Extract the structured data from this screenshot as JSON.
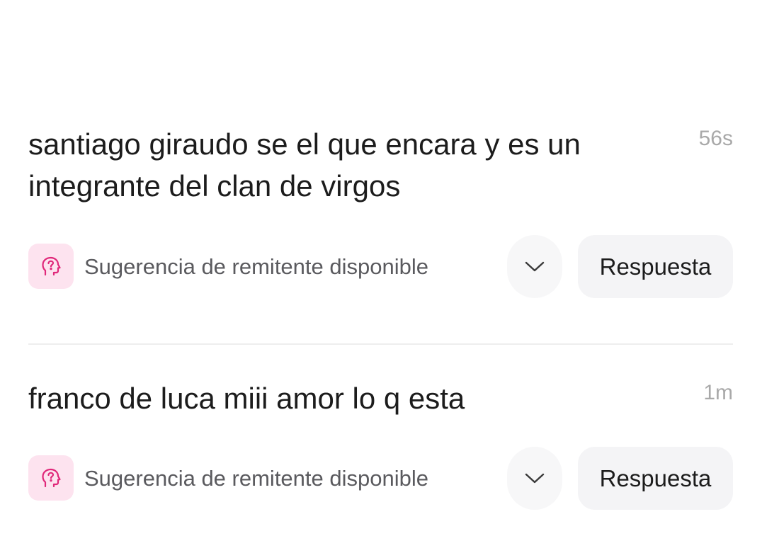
{
  "messages": [
    {
      "text": "santiago giraudo se el que encara y es un integrante del clan de virgos",
      "time": "56s",
      "suggestion_label": "Sugerencia de remitente disponible",
      "suggestion_icon": "head-question-icon",
      "expand_icon": "chevron-down-icon",
      "reply_label": "Respuesta"
    },
    {
      "text": "franco de luca miii amor lo q esta",
      "time": "1m",
      "suggestion_label": "Sugerencia de remitente disponible",
      "suggestion_icon": "head-question-icon",
      "expand_icon": "chevron-down-icon",
      "reply_label": "Respuesta"
    }
  ],
  "colors": {
    "accent_pink": "#e0287a",
    "icon_bg_pink": "#fde3ef",
    "button_bg": "#f4f4f6",
    "timestamp": "#a9a9a9",
    "divider": "#eeeeee"
  }
}
